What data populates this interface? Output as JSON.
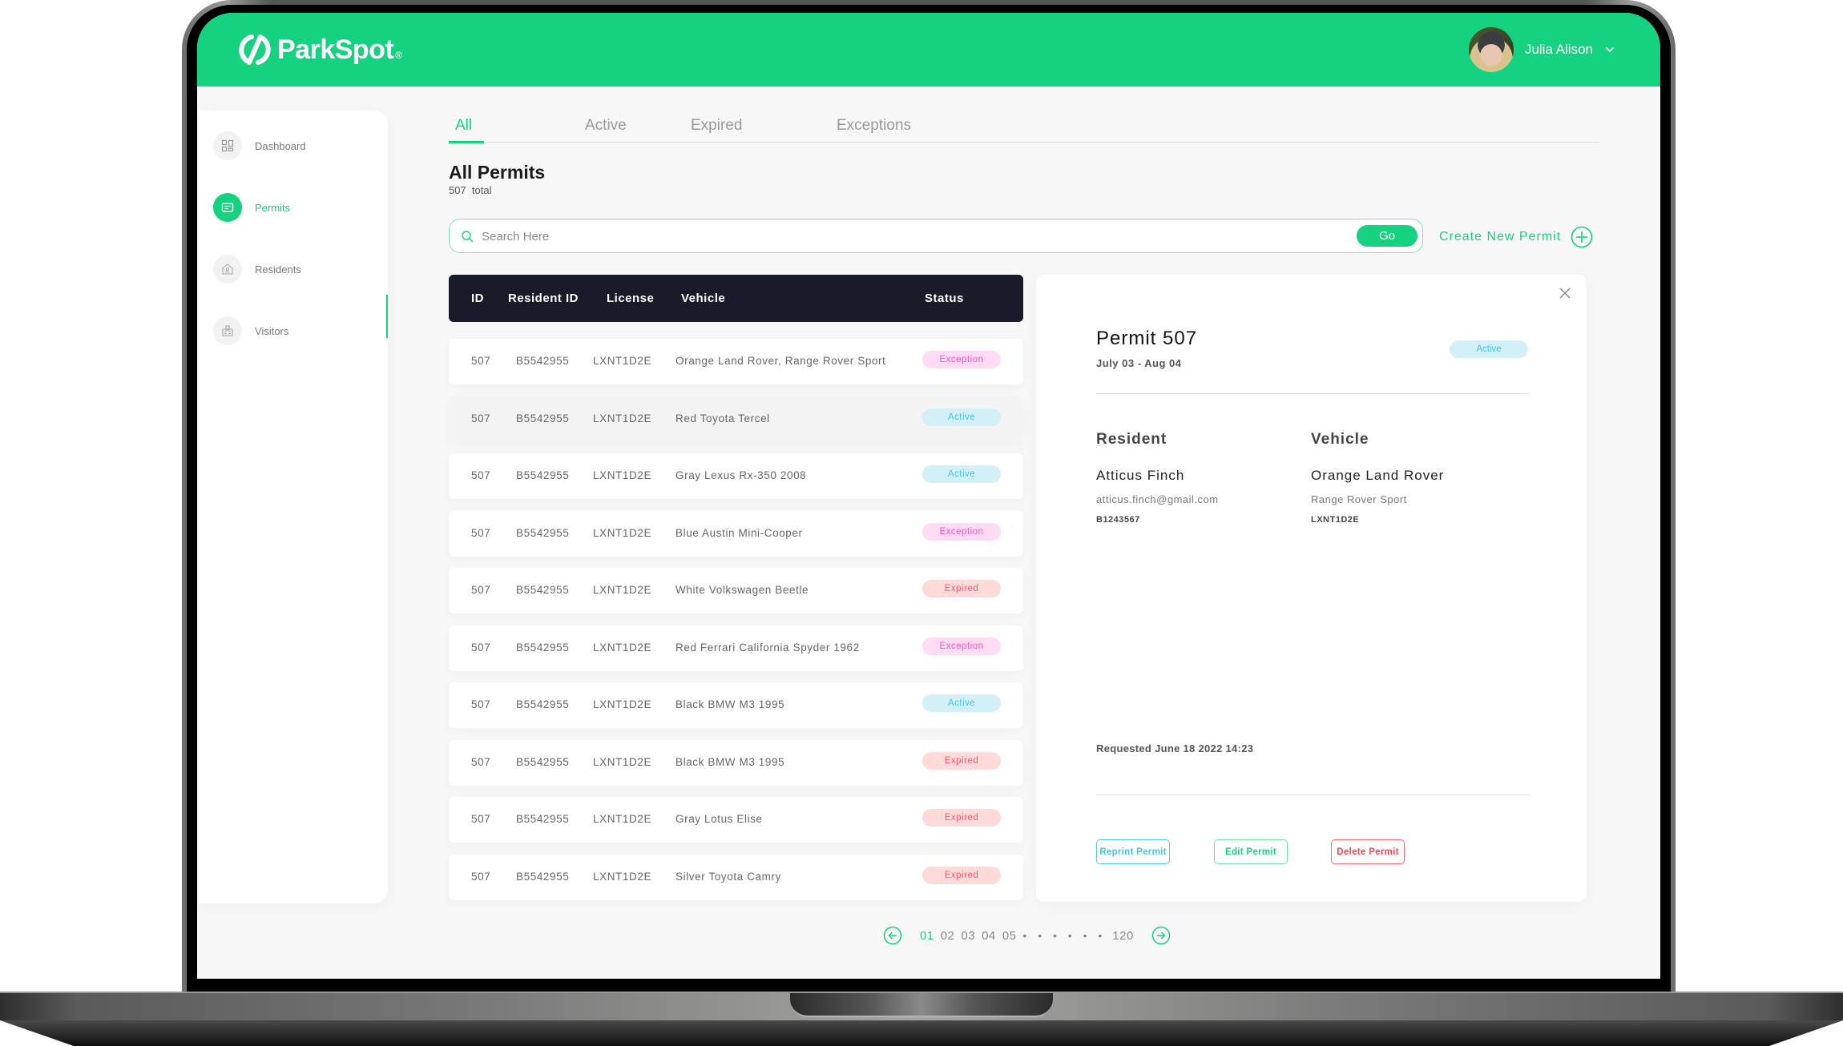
{
  "app": {
    "brand": "ParkSpot",
    "brand_mark": "®",
    "accent_color": "#14d27f"
  },
  "user": {
    "name": "Julia Alison"
  },
  "sidebar": {
    "items": [
      {
        "label": "Dashboard",
        "icon": "dashboard-grid-icon",
        "active": false
      },
      {
        "label": "Permits",
        "icon": "permit-card-icon",
        "active": true
      },
      {
        "label": "Residents",
        "icon": "house-person-icon",
        "active": false
      },
      {
        "label": "Visitors",
        "icon": "visitor-badge-icon",
        "active": false
      }
    ]
  },
  "tabs": [
    {
      "label": "All",
      "active": true
    },
    {
      "label": "Active",
      "active": false
    },
    {
      "label": "Expired",
      "active": false
    },
    {
      "label": "Exceptions",
      "active": false
    }
  ],
  "page": {
    "title": "All Permits",
    "total_count": "507",
    "total_label": "total",
    "subtitle": "507  total"
  },
  "search": {
    "placeholder": "Search Here",
    "value": "",
    "go_label": "Go"
  },
  "create_button": {
    "label": "Create New Permit"
  },
  "table": {
    "columns": [
      "ID",
      "Resident ID",
      "License",
      "Vehicle",
      "Status"
    ],
    "rows": [
      {
        "id": "507",
        "resident_id": "B5542955",
        "license": "LXNT1D2E",
        "vehicle": "Orange Land Rover, Range Rover Sport",
        "status": "Exception"
      },
      {
        "id": "507",
        "resident_id": "B5542955",
        "license": "LXNT1D2E",
        "vehicle": "Red Toyota Tercel",
        "status": "Active"
      },
      {
        "id": "507",
        "resident_id": "B5542955",
        "license": "LXNT1D2E",
        "vehicle": "Gray Lexus Rx-350 2008",
        "status": "Active"
      },
      {
        "id": "507",
        "resident_id": "B5542955",
        "license": "LXNT1D2E",
        "vehicle": "Blue Austin Mini-Cooper",
        "status": "Exception"
      },
      {
        "id": "507",
        "resident_id": "B5542955",
        "license": "LXNT1D2E",
        "vehicle": "White Volkswagen Beetle",
        "status": "Expired"
      },
      {
        "id": "507",
        "resident_id": "B5542955",
        "license": "LXNT1D2E",
        "vehicle": "Red Ferrari California Spyder 1962",
        "status": "Exception"
      },
      {
        "id": "507",
        "resident_id": "B5542955",
        "license": "LXNT1D2E",
        "vehicle": "Black BMW M3 1995",
        "status": "Active"
      },
      {
        "id": "507",
        "resident_id": "B5542955",
        "license": "LXNT1D2E",
        "vehicle": "Black BMW M3 1995",
        "status": "Expired"
      },
      {
        "id": "507",
        "resident_id": "B5542955",
        "license": "LXNT1D2E",
        "vehicle": "Gray Lotus Elise",
        "status": "Expired"
      },
      {
        "id": "507",
        "resident_id": "B5542955",
        "license": "LXNT1D2E",
        "vehicle": "Silver Toyota Camry",
        "status": "Expired"
      }
    ]
  },
  "status_colors": {
    "Exception": {
      "bg": "#ffdcf3",
      "fg": "#ff4fc2"
    },
    "Active": {
      "bg": "#d3f0f8",
      "fg": "#3ec6ea"
    },
    "Expired": {
      "bg": "#ffdada",
      "fg": "#ff5a6a"
    }
  },
  "detail": {
    "title": "Permit 507",
    "dates": "July 03 - Aug 04",
    "status": "Active",
    "resident": {
      "heading": "Resident",
      "name": "Atticus Finch",
      "email": "atticus.finch@gmail.com",
      "id": "B1243567"
    },
    "vehicle": {
      "heading": "Vehicle",
      "name": "Orange Land Rover",
      "model": "Range Rover Sport",
      "license": "LXNT1D2E"
    },
    "requested": "Requested June 18 2022 14:23",
    "buttons": {
      "reprint": "Reprint Permit",
      "edit": "Edit Permit",
      "delete": "Delete Permit"
    }
  },
  "pagination": {
    "pages": [
      "01",
      "02",
      "03",
      "04",
      "05"
    ],
    "current": "01",
    "ellipsis": "• • • • • •",
    "last": "120"
  }
}
